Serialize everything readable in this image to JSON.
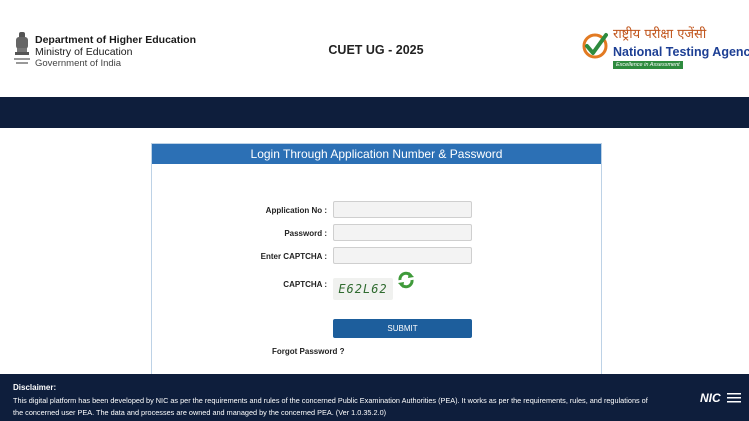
{
  "header": {
    "dept_title": "Department of Higher Education",
    "ministry": "Ministry of Education",
    "government": "Government of India",
    "exam_title": "CUET UG - 2025",
    "nta_hindi": "राष्ट्रीय परीक्षा एजेंसी",
    "nta_name": "National Testing Agency",
    "nta_tagline": "Excellence in Assessment"
  },
  "login": {
    "heading": "Login Through Application Number & Password",
    "application_label": "Application No :",
    "application_value": "",
    "password_label": "Password :",
    "password_value": "",
    "enter_captcha_label": "Enter CAPTCHA :",
    "enter_captcha_value": "",
    "captcha_label": "CAPTCHA :",
    "captcha_text": "E62L62",
    "submit_label": "SUBMIT",
    "forgot_label": "Forgot Password ?"
  },
  "footer": {
    "disclaimer_title": "Disclaimer:",
    "disclaimer_text": "This digital platform has been developed by NIC as per the requirements and rules of the concerned Public Examination Authorities (PEA). It works as per the requirements, rules, and regulations of the concerned user PEA. The data and processes are owned and managed by the concerned PEA. (Ver 1.0.35.2.0)",
    "nic_label": "NIC"
  },
  "colors": {
    "navbar": "#0e1e3c",
    "panel_heading": "#2c70b5",
    "submit_button": "#1d5e9c",
    "nta_blue": "#1d3f94",
    "nta_orange": "#c0541b",
    "nta_green": "#2e8b3e"
  },
  "icons": {
    "emblem": "national-emblem-icon",
    "nta_logo": "nta-checkmark-logo",
    "captcha_refresh": "refresh-icon",
    "nic": "nic-logo"
  }
}
